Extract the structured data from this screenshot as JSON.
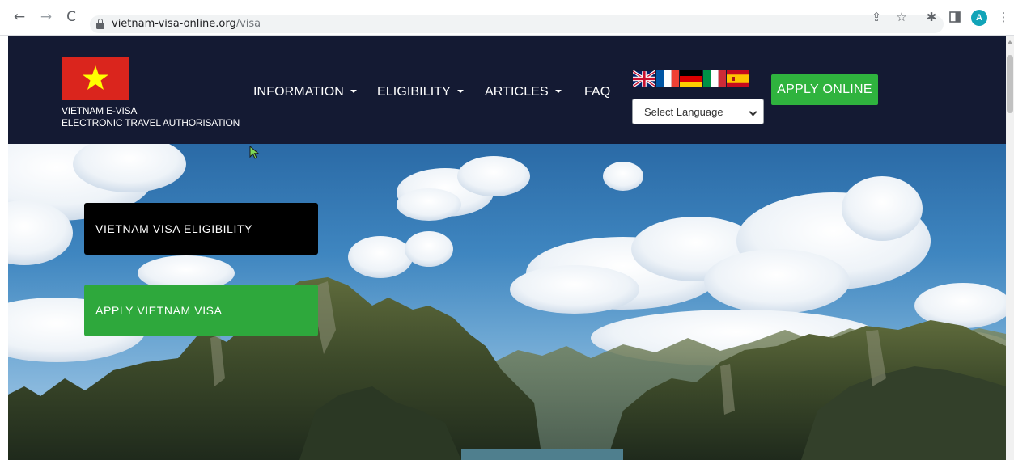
{
  "browser": {
    "url_domain": "vietnam-visa-online.org",
    "url_path": "/visa",
    "back_icon": "back-arrow-icon",
    "forward_icon": "forward-arrow-icon",
    "reload_icon": "reload-icon",
    "avatar_initial": "A"
  },
  "header": {
    "brand_line1": "VIETNAM E-VISA",
    "brand_line2": "ELECTRONIC TRAVEL AUTHORISATION",
    "nav": [
      {
        "label": "INFORMATION"
      },
      {
        "label": "ELIGIBILITY"
      },
      {
        "label": "ARTICLES"
      },
      {
        "label": "FAQ"
      }
    ],
    "language_select": {
      "value": "Select Language"
    },
    "apply_online": "APPLY ONLINE",
    "colors": {
      "header_bg": "#141a33",
      "apply_green": "#2fb33e",
      "flag_red": "#da251d",
      "flag_star": "#ffff00"
    }
  },
  "hero": {
    "eligibility_button": "VIETNAM VISA ELIGIBILITY",
    "apply_button": "APPLY VIETNAM VISA"
  }
}
